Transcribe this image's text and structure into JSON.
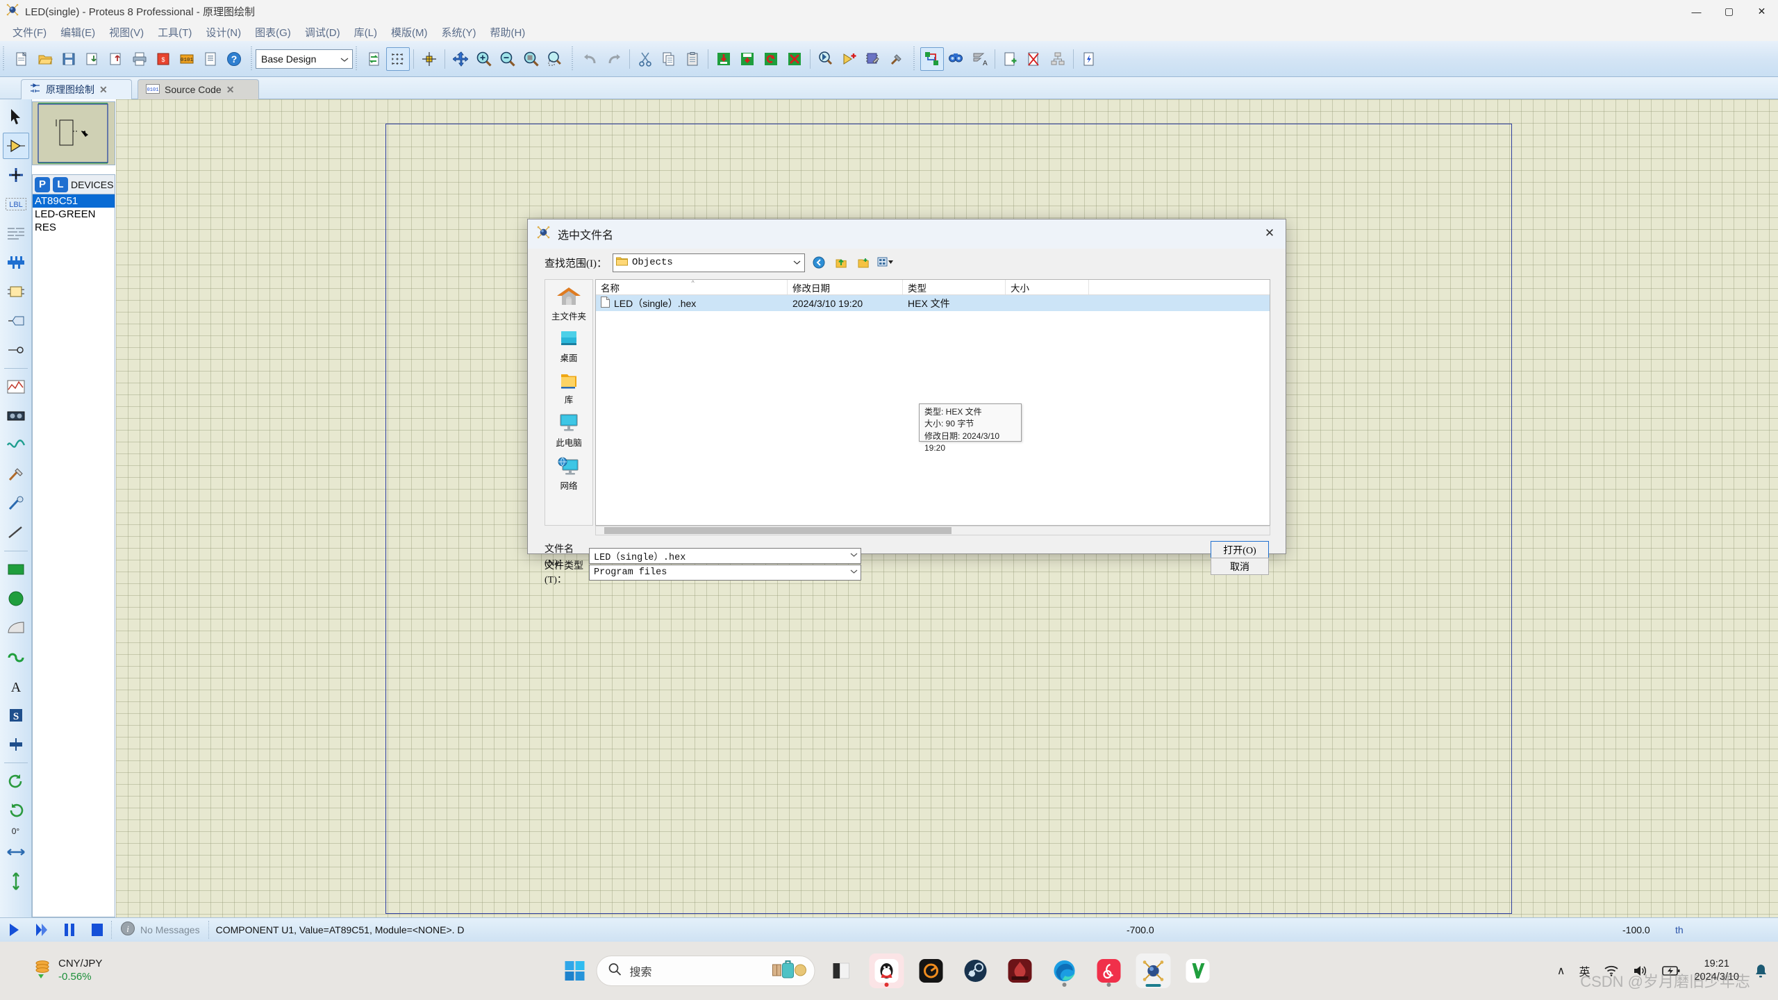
{
  "window": {
    "title": "LED(single) - Proteus 8 Professional - 原理图绘制",
    "app_icon": "proteus-icon",
    "buttons": {
      "minimize": "—",
      "maximize": "▢",
      "close": "✕"
    }
  },
  "menubar": {
    "items": [
      {
        "label": "文件(F)",
        "name": "menu-file"
      },
      {
        "label": "编辑(E)",
        "name": "menu-edit"
      },
      {
        "label": "视图(V)",
        "name": "menu-view"
      },
      {
        "label": "工具(T)",
        "name": "menu-tools"
      },
      {
        "label": "设计(N)",
        "name": "menu-design"
      },
      {
        "label": "图表(G)",
        "name": "menu-graph"
      },
      {
        "label": "调试(D)",
        "name": "menu-debug"
      },
      {
        "label": "库(L)",
        "name": "menu-library"
      },
      {
        "label": "模版(M)",
        "name": "menu-template"
      },
      {
        "label": "系统(Y)",
        "name": "menu-system"
      },
      {
        "label": "帮助(H)",
        "name": "menu-help"
      }
    ]
  },
  "toolbar": {
    "design_combo_value": "Base Design",
    "icons": [
      "new-project-icon",
      "open-project-icon",
      "save-project-icon",
      "import-icon",
      "export-icon",
      "print-icon",
      "bom-icon",
      "netlist-icon",
      "notes-icon",
      "help-icon"
    ]
  },
  "tabs": [
    {
      "label": "原理图绘制",
      "icon": "schematic-icon",
      "selected": true,
      "close": "✕"
    },
    {
      "label": "Source Code",
      "icon": "source-code-icon",
      "selected": false,
      "close": "✕"
    }
  ],
  "toolbox": {
    "rotation_label": "0°",
    "tools": [
      "selection-mode-icon",
      "component-mode-icon",
      "junction-dot-icon",
      "wire-label-icon",
      "text-script-icon",
      "bus-icon",
      "subcircuit-icon",
      "terminal-icon",
      "device-pin-icon",
      "graph-icon",
      "tape-recorder-icon",
      "generator-icon",
      "voltage-probe-icon",
      "current-probe-icon",
      "virtual-instrument-icon",
      "line-icon",
      "box-icon",
      "circle-icon",
      "arc-icon",
      "path-icon",
      "text-icon",
      "symbol-icon",
      "marker-icon"
    ]
  },
  "panels": {
    "devices_header": {
      "p_badge": "P",
      "l_badge": "L",
      "label": "DEVICES"
    },
    "devices": [
      {
        "name": "AT89C51",
        "selected": true
      },
      {
        "name": "LED-GREEN",
        "selected": false
      },
      {
        "name": "RES",
        "selected": false
      }
    ]
  },
  "dialog": {
    "title": "选中文件名",
    "icon": "proteus-icon",
    "close_label": "✕",
    "lookin": {
      "label": "查找范围(I)：",
      "value": "Objects",
      "folder_icon": "folder-icon",
      "nav_buttons": [
        "back-icon",
        "up-folder-icon",
        "new-folder-icon",
        "view-mode-icon"
      ]
    },
    "places": [
      {
        "label": "主文件夹",
        "icon": "home-icon"
      },
      {
        "label": "桌面",
        "icon": "desktop-icon"
      },
      {
        "label": "库",
        "icon": "library-folder-icon"
      },
      {
        "label": "此电脑",
        "icon": "this-pc-icon"
      },
      {
        "label": "网络",
        "icon": "network-icon"
      }
    ],
    "filelist": {
      "columns": [
        "名称",
        "修改日期",
        "类型",
        "大小"
      ],
      "sort_indicator": "^",
      "rows": [
        {
          "name": "LED（single）.hex",
          "modified": "2024/3/10 19:20",
          "type": "HEX 文件",
          "size": "",
          "icon": "hex-file-icon",
          "selected": true
        }
      ]
    },
    "tooltip": {
      "lines": [
        "类型: HEX 文件",
        "大小: 90 字节",
        "修改日期: 2024/3/10 19:20"
      ]
    },
    "filename": {
      "label": "文件名(N)：",
      "value": "LED（single）.hex"
    },
    "filetype": {
      "label": "文件类型(T)：",
      "value": "Program files"
    },
    "buttons": {
      "open": "打开(O)",
      "cancel": "取消"
    }
  },
  "statusbar": {
    "animation_buttons": [
      "play-icon",
      "step-icon",
      "pause-icon",
      "stop-icon"
    ],
    "messages_icon": "info-icon",
    "messages": "No Messages",
    "status": "COMPONENT U1, Value=AT89C51, Module=<NONE>. D",
    "coordinate_x": "-700.0",
    "coordinate_y": "-100.0",
    "units": "th"
  },
  "taskbar": {
    "weather": {
      "pair": "CNY/JPY",
      "change": "-0.56%",
      "icon": "coins-icon",
      "arrow": "down-arrow-icon"
    },
    "start_icon": "windows-start-icon",
    "search": {
      "placeholder": "搜索",
      "icon": "search-icon",
      "widget_icon": "travel-widget-icon"
    },
    "apps": [
      {
        "name": "file-explorer-icon",
        "running": false
      },
      {
        "name": "qq-icon",
        "running": true,
        "highlight": "#fbe4e6"
      },
      {
        "name": "wegame-icon",
        "running": false
      },
      {
        "name": "steam-icon",
        "running": false
      },
      {
        "name": "naraka-icon",
        "running": false
      },
      {
        "name": "edge-icon",
        "running": true
      },
      {
        "name": "netease-music-icon",
        "running": true
      },
      {
        "name": "proteus-icon",
        "running": true,
        "active": true
      },
      {
        "name": "keil-icon",
        "running": false
      }
    ],
    "tray": {
      "overflow": "∧",
      "ime": "英",
      "wifi_icon": "wifi-icon",
      "volume_icon": "volume-icon",
      "battery_icon": "battery-charging-icon",
      "time": "19:21",
      "date": "2024/3/10",
      "notification_icon": "bell-icon"
    },
    "watermark": "CSDN @岁月磨旧少年志"
  }
}
